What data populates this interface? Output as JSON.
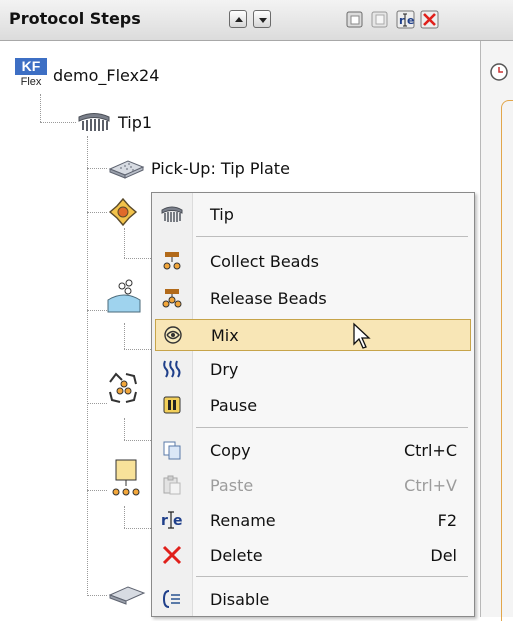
{
  "panel": {
    "title": "Protocol Steps",
    "buttons": [
      "move-up",
      "move-down",
      "copy",
      "paste",
      "rename",
      "delete"
    ]
  },
  "tree": {
    "root": {
      "badge_top": "KF",
      "badge_bottom": "Flex",
      "label": "demo_Flex24"
    },
    "tip": {
      "label": "Tip1"
    },
    "pickup": {
      "label": "Pick-Up: Tip Plate"
    }
  },
  "context_menu": {
    "items": [
      {
        "label": "Tip",
        "shortcut": "",
        "icon": "tip-icon",
        "disabled": false
      },
      {
        "label": "Collect Beads",
        "shortcut": "",
        "icon": "collect-beads-icon",
        "disabled": false
      },
      {
        "label": "Release Beads",
        "shortcut": "",
        "icon": "release-beads-icon",
        "disabled": false
      },
      {
        "label": "Mix",
        "shortcut": "",
        "icon": "mix-icon",
        "disabled": false,
        "highlighted": true
      },
      {
        "label": "Dry",
        "shortcut": "",
        "icon": "dry-icon",
        "disabled": false
      },
      {
        "label": "Pause",
        "shortcut": "",
        "icon": "pause-icon",
        "disabled": false
      },
      {
        "label": "Copy",
        "shortcut": "Ctrl+C",
        "icon": "copy-icon",
        "disabled": false
      },
      {
        "label": "Paste",
        "shortcut": "Ctrl+V",
        "icon": "paste-icon",
        "disabled": true
      },
      {
        "label": "Rename",
        "shortcut": "F2",
        "icon": "rename-icon",
        "disabled": false
      },
      {
        "label": "Delete",
        "shortcut": "Del",
        "icon": "delete-icon",
        "disabled": false
      },
      {
        "label": "Disable",
        "shortcut": "",
        "icon": "disable-icon",
        "disabled": false
      }
    ]
  },
  "colors": {
    "highlight_bg": "#f8e6b6",
    "highlight_border": "#c7a44a",
    "delete_red": "#e0201b",
    "badge_blue": "#3d6fc4"
  }
}
